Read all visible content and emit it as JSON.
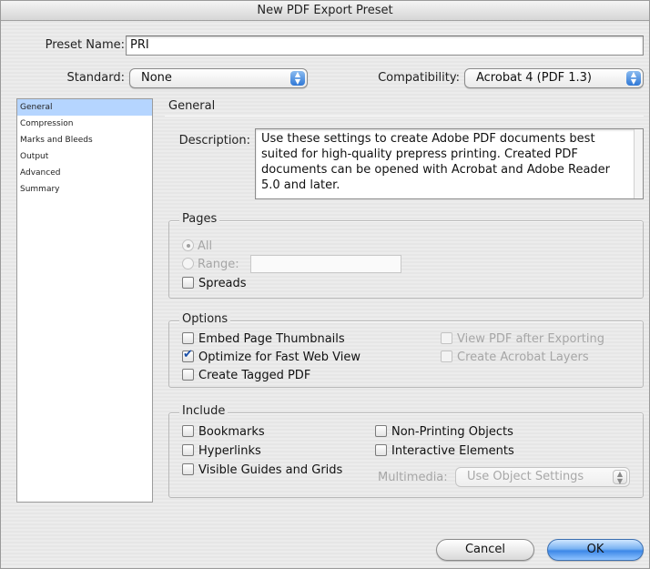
{
  "window": {
    "title": "New PDF Export Preset"
  },
  "preset": {
    "label": "Preset Name:",
    "value": "PRI"
  },
  "standard": {
    "label": "Standard:",
    "value": "None"
  },
  "compatibility": {
    "label": "Compatibility:",
    "value": "Acrobat 4 (PDF 1.3)"
  },
  "sidebar": {
    "items": [
      {
        "label": "General",
        "selected": true
      },
      {
        "label": "Compression"
      },
      {
        "label": "Marks and Bleeds"
      },
      {
        "label": "Output"
      },
      {
        "label": "Advanced"
      },
      {
        "label": "Summary"
      }
    ]
  },
  "general": {
    "title": "General",
    "description_label": "Description:",
    "description_text": "Use these settings to create Adobe PDF documents best suited for high-quality prepress printing.  Created PDF documents can be opened with Acrobat and Adobe Reader 5.0 and later."
  },
  "pages": {
    "title": "Pages",
    "all_label": "All",
    "range_label": "Range:",
    "range_value": "",
    "spreads_label": "Spreads"
  },
  "options": {
    "title": "Options",
    "embed_thumbnails": "Embed Page Thumbnails",
    "optimize_web": "Optimize for Fast Web View",
    "create_tagged": "Create Tagged PDF",
    "view_after_export": "View PDF after Exporting",
    "create_layers": "Create Acrobat Layers"
  },
  "include": {
    "title": "Include",
    "bookmarks": "Bookmarks",
    "hyperlinks": "Hyperlinks",
    "visible_guides": "Visible Guides and Grids",
    "non_printing": "Non-Printing Objects",
    "interactive": "Interactive Elements",
    "multimedia_label": "Multimedia:",
    "multimedia_value": "Use Object Settings"
  },
  "buttons": {
    "cancel": "Cancel",
    "ok": "OK"
  },
  "icons": {
    "popup_arrows": "updown-arrows-icon",
    "checkmark": "checkmark-icon"
  }
}
